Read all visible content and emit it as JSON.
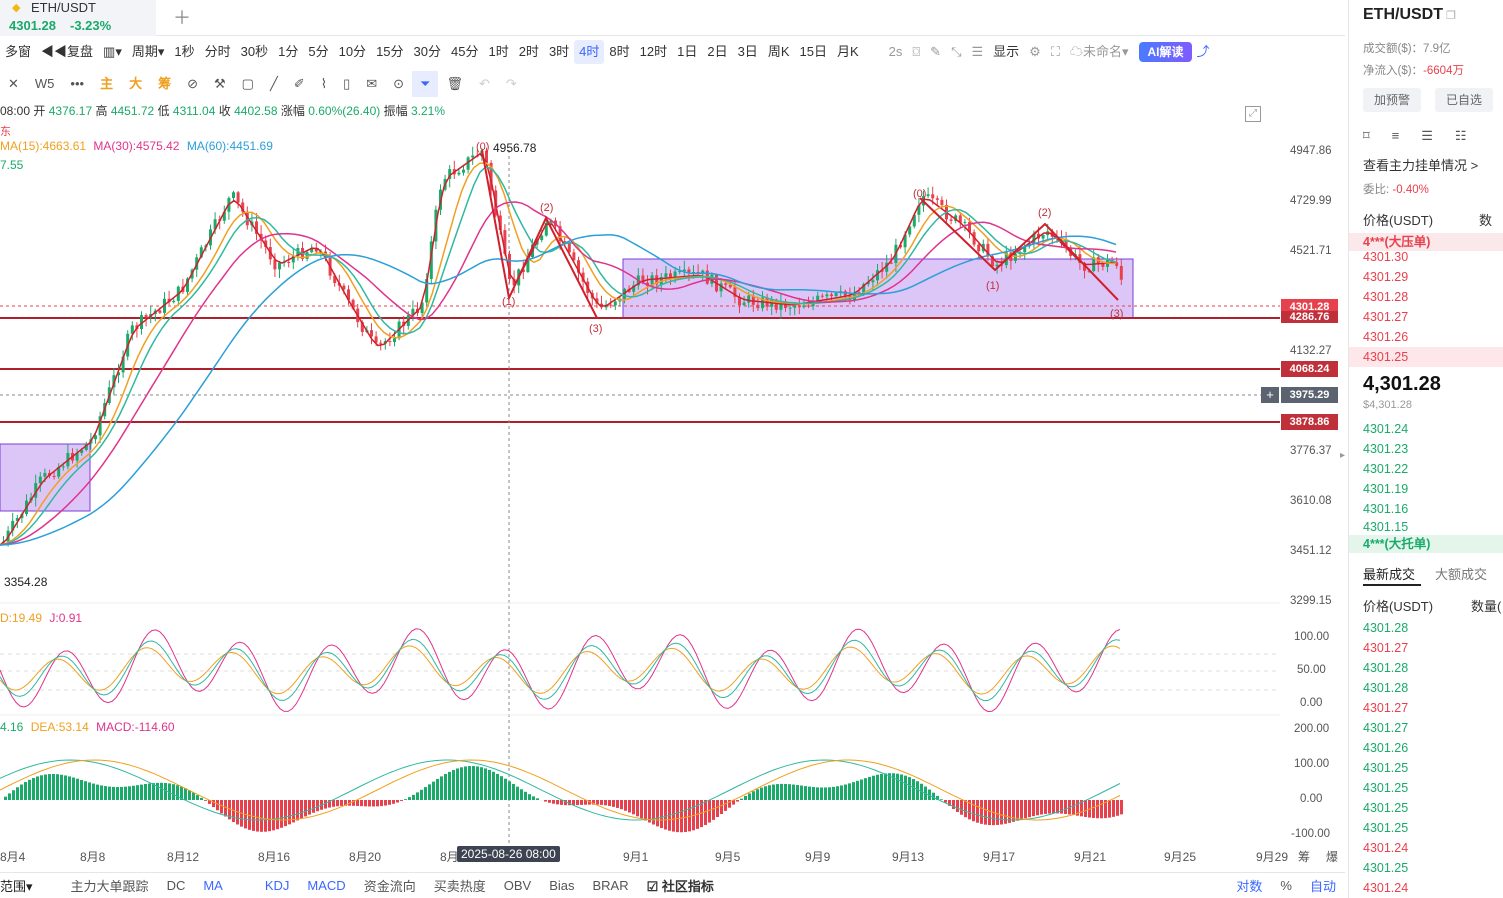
{
  "tab": {
    "symbol": "ETH/USDT",
    "price": "4301.28",
    "change": "-3.23%"
  },
  "toolbar": {
    "items": [
      "多窗",
      "复盘",
      "",
      "周期",
      "1秒",
      "分时",
      "30秒",
      "1分",
      "5分",
      "10分",
      "15分",
      "30分",
      "45分",
      "1时",
      "2时",
      "3时",
      "4时",
      "8时",
      "12时",
      "1日",
      "2日",
      "3日",
      "周K",
      "15日",
      "月K"
    ],
    "active": "4时",
    "right": [
      "2s",
      "显示",
      "未命名",
      "AI解读"
    ]
  },
  "drawbar": {
    "items": [
      "W5",
      "主",
      "大",
      "筹"
    ]
  },
  "info": {
    "time": "08:00",
    "open_label": "开",
    "open": "4376.17",
    "high_label": "高",
    "high": "4451.72",
    "low_label": "低",
    "low": "4311.04",
    "close_label": "收",
    "close": "4402.58",
    "chg_label": "涨幅",
    "chg": "0.60%(26.40)",
    "amp_label": "振幅",
    "amp": "3.21%"
  },
  "ma": {
    "ma15": "MA(15):4663.61",
    "ma30": "MA(30):4575.42",
    "ma60": "MA(60):4451.69",
    "extra": "7.55",
    "marker": "东"
  },
  "kdj": {
    "d": "D:19.49",
    "j": "J:0.91"
  },
  "macd": {
    "dif": "4.16",
    "dea": "DEA:53.14",
    "macd": "MACD:-114.60"
  },
  "chart_data": {
    "type": "candlestick",
    "price_axis": [
      "4947.86",
      "4729.99",
      "4521.71",
      "4132.27",
      "3776.37",
      "3610.08",
      "3451.12",
      "3299.15"
    ],
    "price_tags": [
      {
        "v": "4301.28",
        "color": "#e8414e"
      },
      {
        "v": "4286.76",
        "color": "#c0303a"
      },
      {
        "v": "4068.24",
        "color": "#c0303a"
      },
      {
        "v": "3975.29",
        "color": "#5b6270"
      },
      {
        "v": "3878.86",
        "color": "#c0303a"
      }
    ],
    "annotations": {
      "high": "4956.78",
      "low": "3354.28"
    },
    "kdj_axis": [
      "100.00",
      "50.00",
      "0.00"
    ],
    "macd_axis": [
      "200.00",
      "100.00",
      "0.00",
      "-100.00"
    ],
    "x_labels": [
      "8月4",
      "8月8",
      "8月12",
      "8月16",
      "8月20",
      "8月",
      "9月1",
      "9月5",
      "9月9",
      "9月13",
      "9月17",
      "9月21",
      "9月25",
      "9月29"
    ],
    "crosshair_date": "2025-08-26 08:00"
  },
  "bottombar": [
    "范围",
    "主力大单跟踪",
    "DC",
    "MA",
    "KDJ",
    "MACD",
    "资金流向",
    "买卖热度",
    "OBV",
    "Bias",
    "BRAR",
    "社区指标",
    "对数",
    "%",
    "自动"
  ],
  "right": {
    "symbol": "ETH/USDT",
    "vol": "成交额($)：7.9亿",
    "net_label": "净流入($)：",
    "net": "-6604万",
    "btn1": "加预警",
    "btn2": "已自选",
    "book_link": "查看主力挂单情况 >",
    "ratio_label": "委比:",
    "ratio": "-0.40%",
    "price_header": "价格(USDT)",
    "qty_header": "数量",
    "sell_band": "4***(大压单)",
    "asks": [
      "4301.30",
      "4301.29",
      "4301.28",
      "4301.27",
      "4301.26",
      "4301.25"
    ],
    "last": "4,301.28",
    "last_usd": "$4,301.28",
    "bids": [
      "4301.24",
      "4301.23",
      "4301.22",
      "4301.19",
      "4301.16",
      "4301.15"
    ],
    "buy_band": "4***(大托单)",
    "trades_tab1": "最新成交",
    "trades_tab2": "大额成交",
    "trades_qty": "数量(",
    "trades": [
      {
        "p": "4301.28",
        "c": "green"
      },
      {
        "p": "4301.27",
        "c": "red"
      },
      {
        "p": "4301.28",
        "c": "green"
      },
      {
        "p": "4301.28",
        "c": "green"
      },
      {
        "p": "4301.27",
        "c": "red"
      },
      {
        "p": "4301.27",
        "c": "green"
      },
      {
        "p": "4301.26",
        "c": "green"
      },
      {
        "p": "4301.25",
        "c": "green"
      },
      {
        "p": "4301.25",
        "c": "green"
      },
      {
        "p": "4301.25",
        "c": "green"
      },
      {
        "p": "4301.25",
        "c": "green"
      },
      {
        "p": "4301.24",
        "c": "red"
      },
      {
        "p": "4301.25",
        "c": "green"
      },
      {
        "p": "4301.24",
        "c": "red"
      }
    ]
  }
}
